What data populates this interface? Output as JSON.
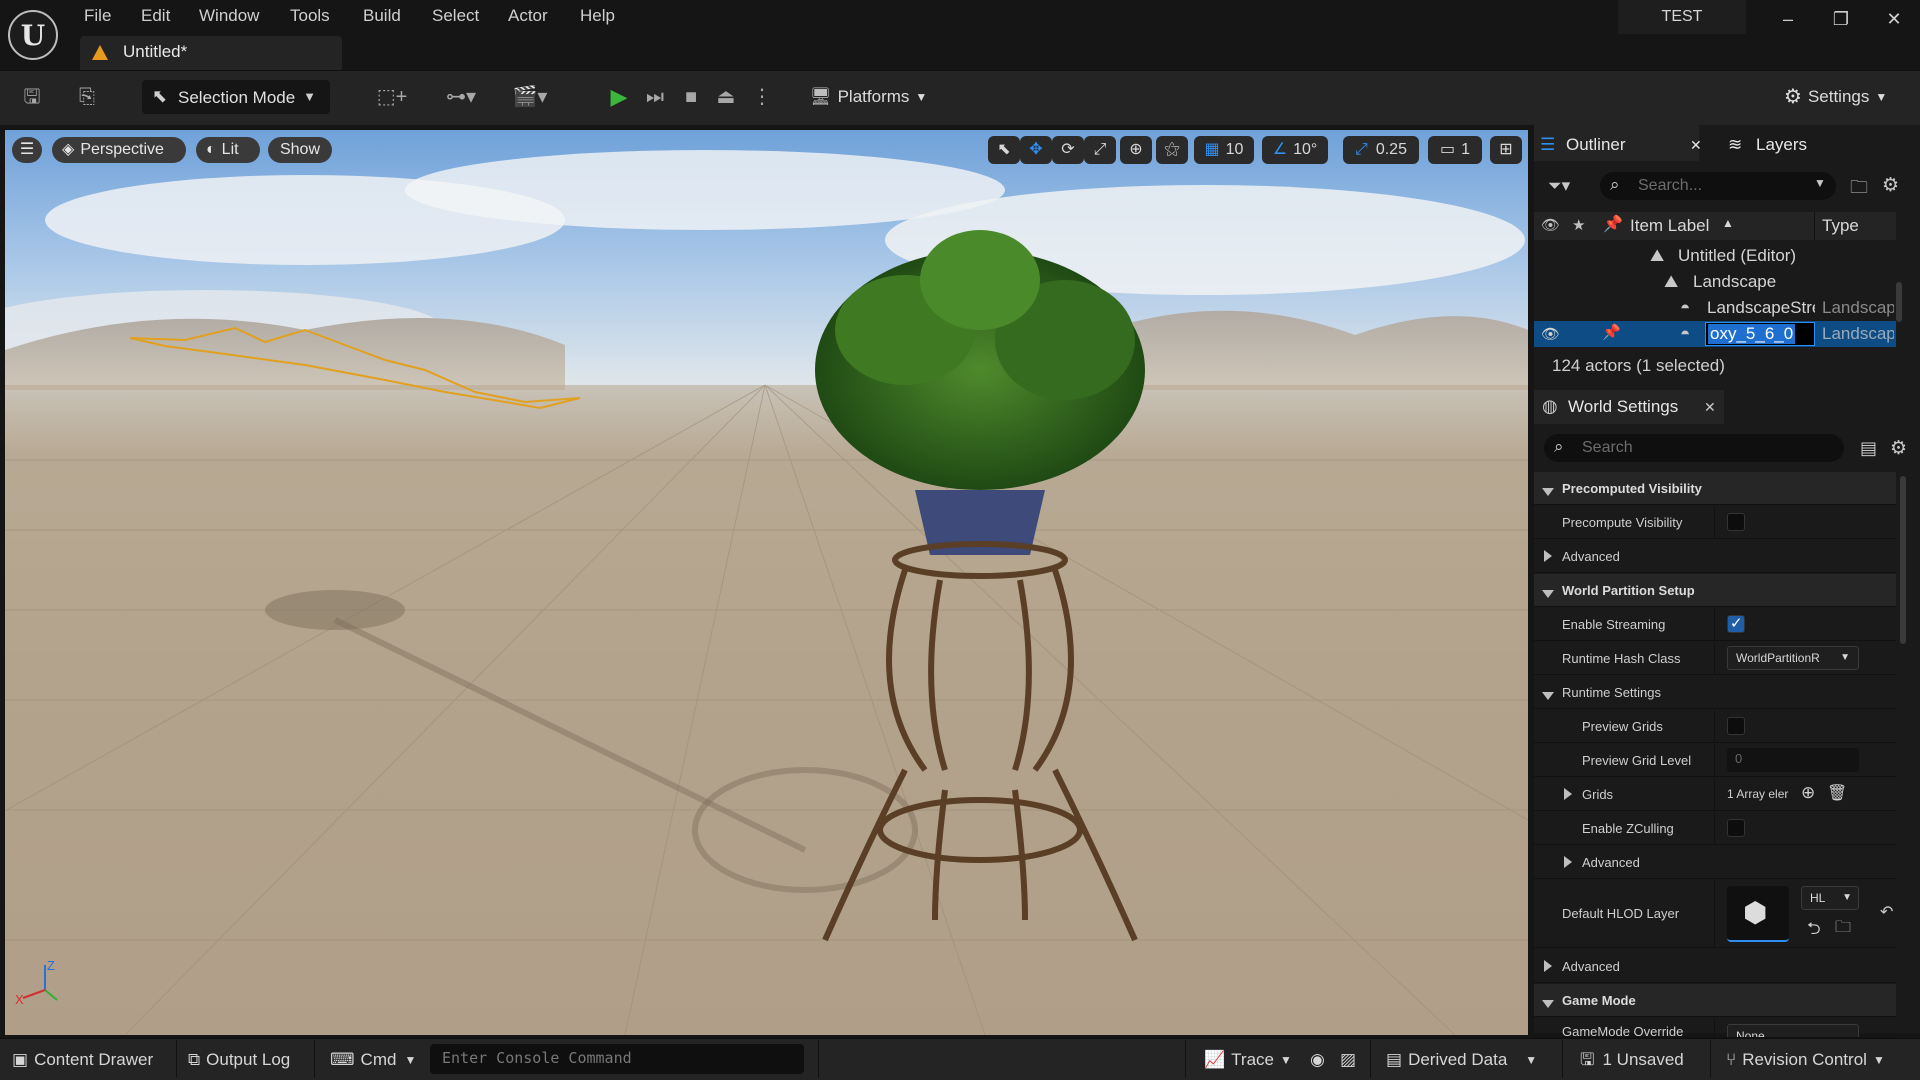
{
  "menu": [
    "File",
    "Edit",
    "Window",
    "Tools",
    "Build",
    "Select",
    "Actor",
    "Help"
  ],
  "tab": {
    "title": "Untitled*"
  },
  "project_name": "TEST",
  "window_buttons": {
    "minimize": "–",
    "restore": "❐",
    "close": "✕"
  },
  "toolbar": {
    "selection_mode": "Selection Mode",
    "platforms": "Platforms",
    "settings": "Settings"
  },
  "viewport": {
    "perspective": "Perspective",
    "lit": "Lit",
    "show": "Show",
    "grid_snap": "10",
    "rotation_snap": "10°",
    "scale_snap": "0.25",
    "camera_speed": "1",
    "axis": {
      "z": "Z",
      "x": "X"
    }
  },
  "outliner": {
    "tab_label": "Outliner",
    "layers_label": "Layers",
    "search_placeholder": "Search...",
    "col_item_label": "Item Label",
    "col_type": "Type",
    "rows": [
      {
        "label": "Untitled (Editor)",
        "type": ""
      },
      {
        "label": "Landscape",
        "type": ""
      },
      {
        "label": "LandscapeStre",
        "type": "Landscap"
      },
      {
        "label": "oxy_5_6_0",
        "type": "Landscap"
      }
    ],
    "status": "124 actors (1 selected)"
  },
  "world_settings": {
    "tab_label": "World Settings",
    "search_placeholder": "Search",
    "rows": {
      "precomputed_visibility": "Precomputed Visibility",
      "precompute_visibility": "Precompute Visibility",
      "advanced_1": "Advanced",
      "world_partition_setup": "World Partition Setup",
      "enable_streaming": "Enable Streaming",
      "runtime_hash_class": "Runtime Hash Class",
      "runtime_hash_value": "WorldPartitionR",
      "runtime_settings": "Runtime Settings",
      "preview_grids": "Preview Grids",
      "preview_grid_level": "Preview Grid Level",
      "preview_grid_level_value": "0",
      "grids": "Grids",
      "grids_value": "1 Array eler",
      "enable_zculling": "Enable ZCulling",
      "advanced_2": "Advanced",
      "default_hlod_layer": "Default HLOD Layer",
      "hlod_value": "HL",
      "advanced_3": "Advanced",
      "game_mode": "Game Mode",
      "gamemode_override": "GameMode Override",
      "gamemode_override_value": "None"
    },
    "enable_streaming_checked": true
  },
  "statusbar": {
    "content_drawer": "Content Drawer",
    "output_log": "Output Log",
    "cmd": "Cmd",
    "console_placeholder": "Enter Console Command",
    "trace": "Trace",
    "derived_data": "Derived Data",
    "unsaved": "1 Unsaved",
    "revision_control": "Revision Control"
  },
  "colors": {
    "accent_blue": "#0e4c85",
    "play_green": "#3cb73c",
    "warning_orange": "#e79a1f"
  }
}
